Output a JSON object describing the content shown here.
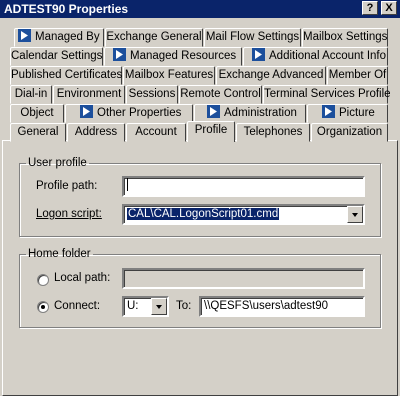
{
  "window": {
    "title": "ADTEST90 Properties",
    "help_label": "?",
    "close_label": "X"
  },
  "tabs": {
    "row1": [
      "Managed By",
      "Exchange General",
      "Mail Flow Settings",
      "Mailbox Settings"
    ],
    "row2": [
      "Calendar Settings",
      "Managed Resources",
      "Additional Account Info"
    ],
    "row3": [
      "Published Certificates",
      "Mailbox Features",
      "Exchange Advanced",
      "Member Of"
    ],
    "row4": [
      "Dial-in",
      "Environment",
      "Sessions",
      "Remote Control",
      "Terminal Services Profile"
    ],
    "row5": [
      "Object",
      "Other Properties",
      "Administration",
      "Picture"
    ],
    "row6": [
      "General",
      "Address",
      "Account",
      "Profile",
      "Telephones",
      "Organization"
    ],
    "active": "Profile"
  },
  "user_profile": {
    "legend": "User profile",
    "profile_path_label": "Profile path:",
    "profile_path_value": "",
    "logon_script_label": "Logon script:",
    "logon_script_value": "CAL\\CAL.LogonScript01.cmd"
  },
  "home_folder": {
    "legend": "Home folder",
    "local_path_label": "Local path:",
    "local_path_value": "",
    "connect_label": "Connect:",
    "drive_value": "U:",
    "to_label": "To:",
    "to_value": "\\\\QESFS\\users\\adtest90",
    "selected": "connect"
  },
  "colors": {
    "titlebar": "#0a246a",
    "face": "#d4d0c8",
    "selection": "#0a246a"
  }
}
